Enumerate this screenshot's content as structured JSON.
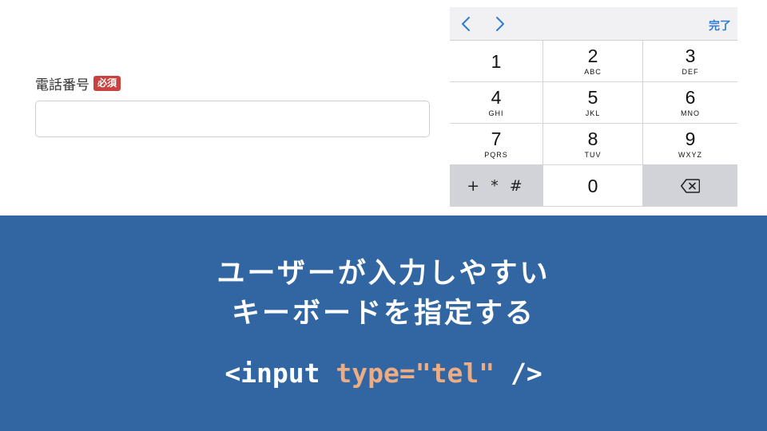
{
  "form": {
    "label": "電話番号",
    "required_badge": "必須",
    "input_value": ""
  },
  "keyboard": {
    "done_label": "完了",
    "nav_icons": [
      "chevron-left-icon",
      "chevron-right-icon"
    ],
    "keys": [
      {
        "digit": "1",
        "letters": ""
      },
      {
        "digit": "2",
        "letters": "ABC"
      },
      {
        "digit": "3",
        "letters": "DEF"
      },
      {
        "digit": "4",
        "letters": "GHI"
      },
      {
        "digit": "5",
        "letters": "JKL"
      },
      {
        "digit": "6",
        "letters": "MNO"
      },
      {
        "digit": "7",
        "letters": "PQRS"
      },
      {
        "digit": "8",
        "letters": "TUV"
      },
      {
        "digit": "9",
        "letters": "WXYZ"
      }
    ],
    "symbols_key": "+ * #",
    "zero_key": "0",
    "delete_icon": "backspace-icon"
  },
  "banner": {
    "line1": "ユーザーが入力しやすい",
    "line2": "キーボードを指定する",
    "code_open": "<input ",
    "code_attr": "type=\"tel\"",
    "code_close": " />"
  },
  "colors": {
    "banner_bg": "#3266a3",
    "required_badge": "#c9423f",
    "accent_blue": "#2d7cd6",
    "code_attr": "#ecac84"
  }
}
